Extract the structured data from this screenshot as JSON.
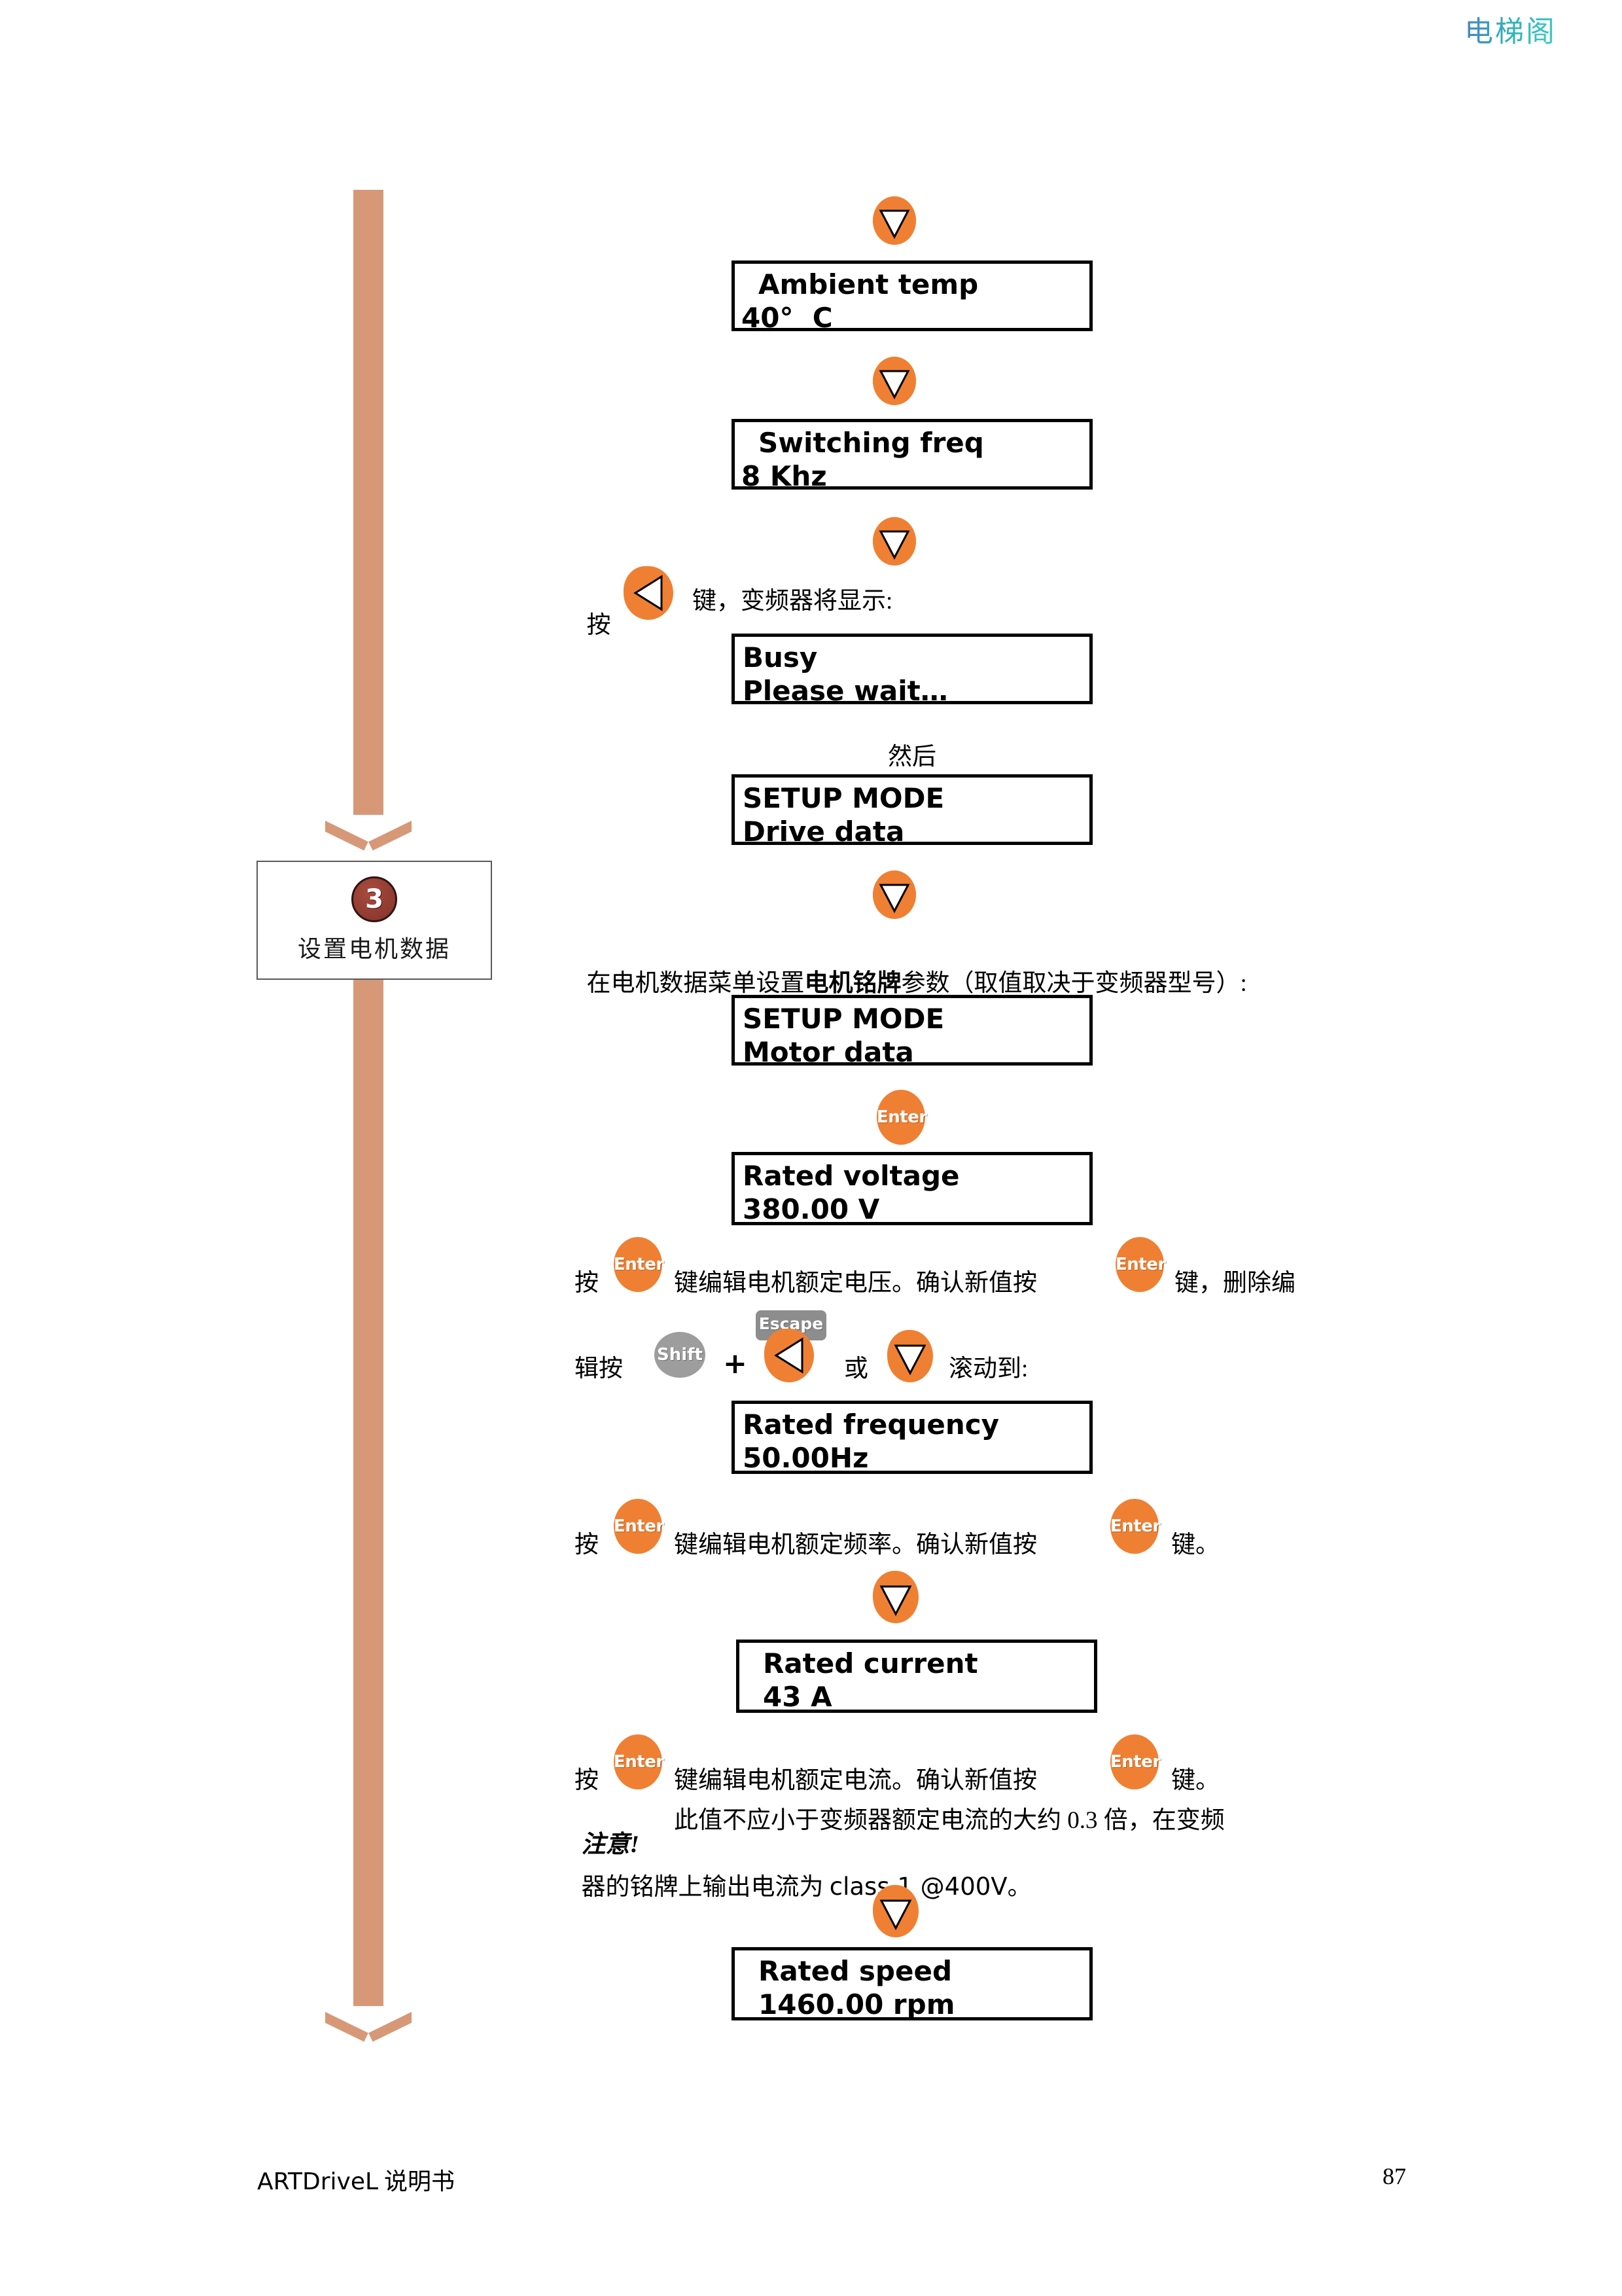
{
  "watermark": "电梯阁",
  "step": {
    "number": "3",
    "label": "设置电机数据"
  },
  "displays": [
    {
      "name": "ambient-temp",
      "line1": "Ambient temp",
      "line2": "40°  C"
    },
    {
      "name": "switching-freq",
      "line1": "Switching freq",
      "line2": "8 Khz"
    },
    {
      "name": "busy",
      "line1": "Busy",
      "line2": "Please wait…"
    },
    {
      "name": "setup-mode-drive",
      "line1": "SETUP MODE",
      "line2": "Drive data"
    },
    {
      "name": "setup-mode-motor",
      "line1": "SETUP MODE",
      "line2": "Motor data"
    },
    {
      "name": "rated-voltage",
      "line1": "Rated voltage",
      "line2": "380.00 V"
    },
    {
      "name": "rated-frequency",
      "line1": "Rated frequency",
      "line2": "50.00Hz"
    },
    {
      "name": "rated-current",
      "line1": "Rated current",
      "line2": "43 A"
    },
    {
      "name": "rated-speed",
      "line1": "Rated speed",
      "line2": "1460.00 rpm"
    }
  ],
  "keys": {
    "enter": "Enter",
    "shift": "Shift",
    "escape": "Escape",
    "down_arrow": "down-arrow",
    "left_arrow": "left-arrow",
    "plus": "+"
  },
  "text": {
    "press_left_key": "按",
    "press_left_key_tail": "键，变频器将显示:",
    "then": "然后",
    "motor_nameplate_a": "在电机数据菜单设置",
    "motor_nameplate_b": "电机铭牌",
    "motor_nameplate_c": "参数（取值取决于变频器型号）:",
    "voltage_line_1a": "按",
    "voltage_line_1b": "键编辑电机额定电压。确认新值按",
    "voltage_line_1c": "键，删除编",
    "voltage_line_2a": "辑按",
    "voltage_line_2b": "或",
    "voltage_line_2c": "滚动到:",
    "frequency_line_a": "按",
    "frequency_line_b": "键编辑电机额定频率。确认新值按",
    "frequency_line_c": "键。",
    "current_line_a": "按",
    "current_line_b": "键编辑电机额定电流。确认新值按",
    "current_line_c": "键。",
    "note_lead": "注意!",
    "note_body_1": "此值不应小于变频器额定电流的大约 0.3 倍，在变频",
    "note_body_2a": "器的铭牌上输出电流为 ",
    "note_body_2b": "class 1 @400V",
    "note_body_2c": "。"
  },
  "footer": {
    "left_latin": "ARTDriveL",
    "left_cjk": " 说明书",
    "page": "87"
  },
  "colors": {
    "key_orange": "#ef8033",
    "key_gray": "#9d9d9d",
    "flow_arrow": "#d79878",
    "step_circle": "#8f3a30",
    "watermark": "#23b3b3"
  }
}
